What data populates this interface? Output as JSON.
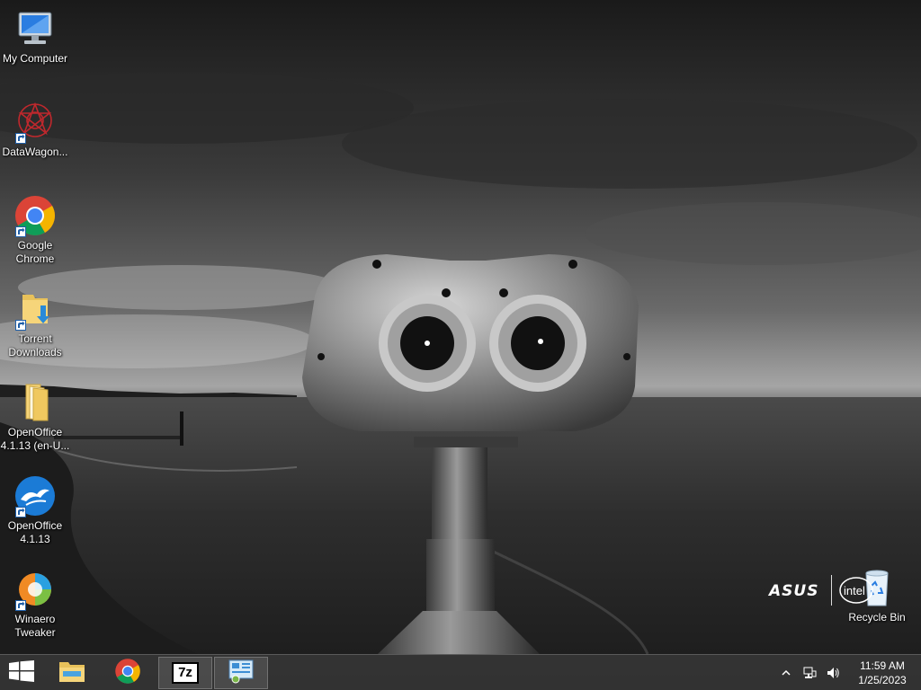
{
  "desktop": {
    "icons": [
      {
        "label": "My Computer",
        "icon": "computer-icon",
        "shortcut": false
      },
      {
        "label": "DataWagon...",
        "icon": "datawagon-icon",
        "shortcut": true
      },
      {
        "label": "Google Chrome",
        "icon": "chrome-icon",
        "shortcut": true
      },
      {
        "label": "Torrent Downloads",
        "icon": "folder-download-icon",
        "shortcut": true
      },
      {
        "label": "OpenOffice 4.1.13 (en-U...",
        "icon": "folder-icon",
        "shortcut": false
      },
      {
        "label": "OpenOffice 4.1.13",
        "icon": "openoffice-icon",
        "shortcut": true
      },
      {
        "label": "Winaero Tweaker",
        "icon": "winaero-icon",
        "shortcut": true
      }
    ],
    "recycle_bin": {
      "label": "Recycle Bin",
      "icon": "recycle-bin-icon"
    },
    "brand": {
      "asus": "ASUS",
      "intel": "intel"
    }
  },
  "taskbar": {
    "start": {
      "icon": "windows-start-icon"
    },
    "pinned": [
      {
        "name": "File Explorer",
        "icon": "file-explorer-icon",
        "active": false
      },
      {
        "name": "Google Chrome",
        "icon": "chrome-icon",
        "active": false
      },
      {
        "name": "7-Zip",
        "icon": "7zip-icon",
        "label": "7z",
        "active": true
      },
      {
        "name": "Control Panel",
        "icon": "control-panel-icon",
        "active": true
      }
    ],
    "tray": {
      "icons": [
        "show-hidden-icons-icon",
        "network-icon",
        "volume-icon"
      ],
      "time": "11:59 AM",
      "date": "1/25/2023"
    }
  },
  "colors": {
    "taskbar": "#373737",
    "chrome_red": "#db4437",
    "chrome_green": "#0f9d58",
    "chrome_yellow": "#f4b400",
    "chrome_blue": "#4285f4"
  }
}
